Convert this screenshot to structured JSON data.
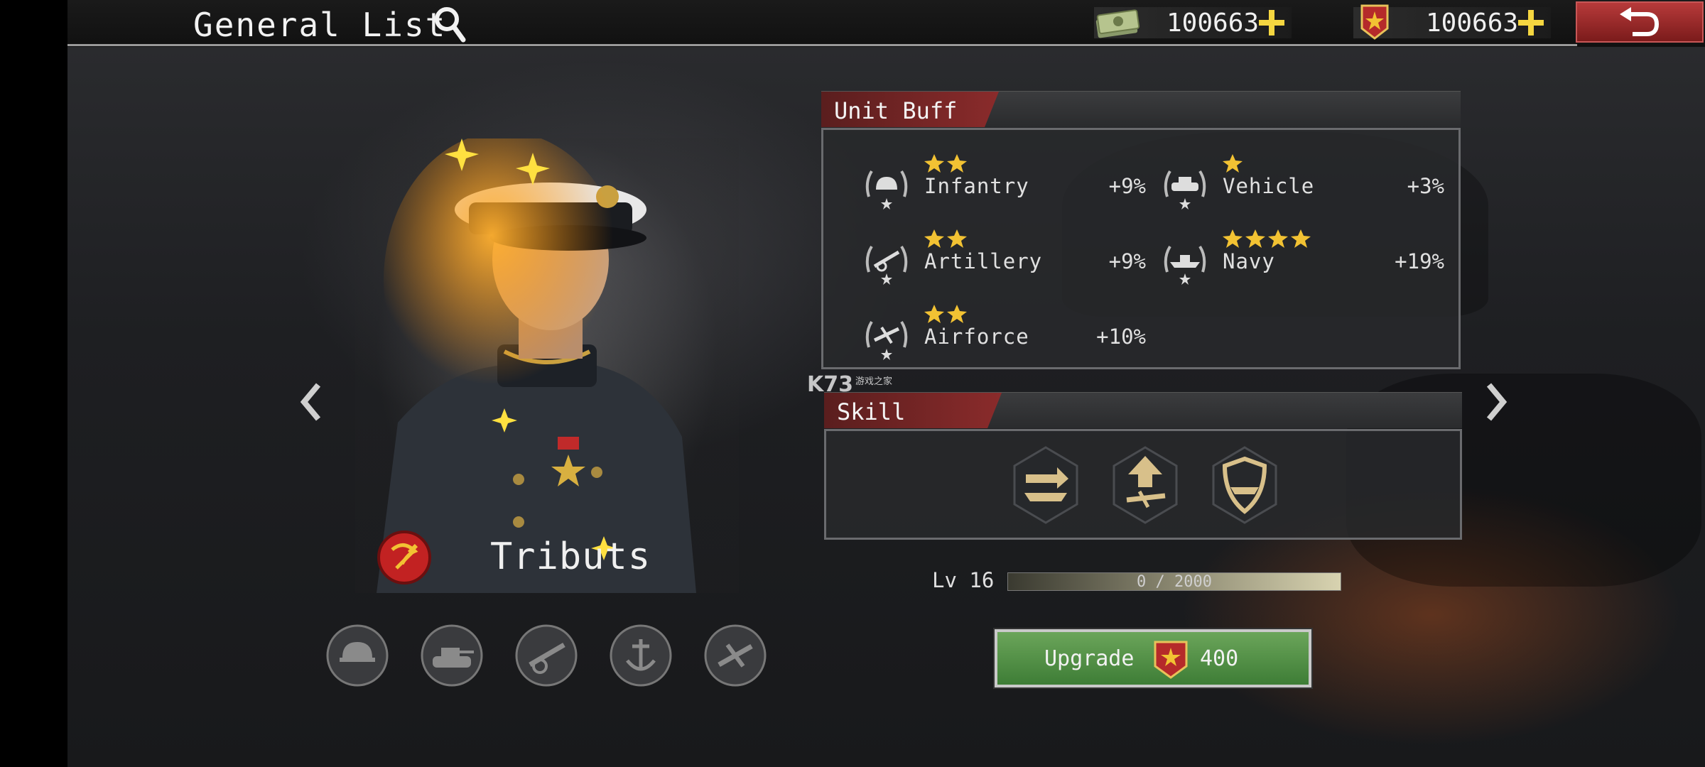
{
  "header": {
    "title": "General List",
    "money": "100663",
    "medals": "100663"
  },
  "commander": {
    "name": "Tributs"
  },
  "unit_buff": {
    "title": "Unit Buff",
    "items": [
      {
        "name": "Infantry",
        "value": "+9%",
        "stars": 2
      },
      {
        "name": "Vehicle",
        "value": "+3%",
        "stars": 1
      },
      {
        "name": "Artillery",
        "value": "+9%",
        "stars": 2
      },
      {
        "name": "Navy",
        "value": "+19%",
        "stars": 4
      },
      {
        "name": "Airforce",
        "value": "+10%",
        "stars": 2
      }
    ]
  },
  "skill": {
    "title": "Skill"
  },
  "level": {
    "label": "Lv",
    "value": "16",
    "xp": "0 / 2000",
    "progress": 0
  },
  "upgrade": {
    "label": "Upgrade",
    "cost": "400"
  },
  "watermark": {
    "text": "K73",
    "sub": "游戏之家"
  },
  "colors": {
    "accent_red": "#8a2b2b",
    "upgrade_green": "#4f8f44",
    "star_gold": "#f2c233"
  }
}
